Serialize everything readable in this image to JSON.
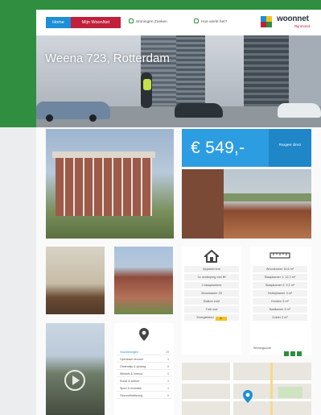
{
  "nav": {
    "tab_home": "Home",
    "tab_mine": "Mijn WoonNet",
    "link_search": "Woningen Zoeken",
    "link_help": "Hoe werkt het?"
  },
  "logo": {
    "brand": "woonnet",
    "sub": "Rijnmond"
  },
  "hero": {
    "title": "Weena 723, Rotterdam"
  },
  "listing": {
    "price": "€ 549,-",
    "respond_button": "Reageer direct"
  },
  "details": {
    "features": [
      "Appartement",
      "1e verdieping met lift",
      "2 slaapkamers",
      "Woonkamer 25",
      "Balkon zuid",
      "Turk oud"
    ],
    "energy_label": "Energielabel",
    "energy_value": "A",
    "sizes": [
      "Woonkamer 16,6 m²",
      "Slaapkamer 1: 12,2 m²",
      "Slaapkamer 2: 9,2 m²",
      "Hobbykamer 3 m²",
      "Keuken 3 m²",
      "Badkamer 3 m²",
      "Zolder 3 m²"
    ],
    "rating_label": "Woningscore"
  },
  "nearby": {
    "items": [
      {
        "label": "Voorzieningen",
        "count": "28"
      },
      {
        "label": "Openbaar vervoer",
        "count": "4"
      },
      {
        "label": "Onderwijs & opvang",
        "count": "8"
      },
      {
        "label": "Winkels & horeca",
        "count": "5"
      },
      {
        "label": "Kunst & cultuur",
        "count": "3"
      },
      {
        "label": "Sport & recreatie",
        "count": "4"
      },
      {
        "label": "Gezondheidszorg",
        "count": "6"
      }
    ]
  },
  "colors": {
    "brand_blue": "#2d9de2",
    "brand_red": "#c0203c",
    "brand_green": "#2f8e3f"
  }
}
